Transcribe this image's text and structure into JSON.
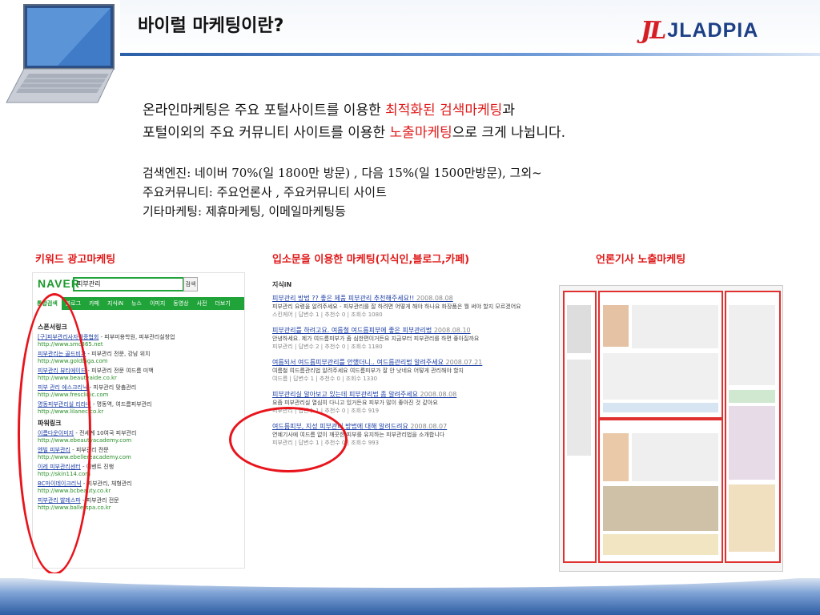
{
  "header": {
    "title": "바이럴 마케팅이란?",
    "logo_mark": "JL",
    "logo_text": "JLADPIA"
  },
  "intro": {
    "line1_a": "온라인마케팅은 주요 포털사이트를 이용한 ",
    "line1_red": "최적화된 검색마케팅",
    "line1_b": "과",
    "line2_a": "포털이외의 주요 커뮤니티 사이트를 이용한  ",
    "line2_red": "노출마케팅",
    "line2_b": "으로 크게 나뉩니다."
  },
  "details": [
    "검색엔진: 네이버 70%(일 1800만 방문) , 다음 15%(일 1500만방문), 그외~",
    "주요커뮤니티: 주요언론사 , 주요커뮤니티 사이트",
    "기타마케팅: 제휴마케팅, 이메일마케팅등"
  ],
  "captions": {
    "left": "키워드 광고마케팅",
    "middle": "입소문을 이용한 마케팅(지식인,블로그,카페)",
    "right": "언론기사 노출마케팅"
  },
  "naver": {
    "logo": "NAVER",
    "query": "피부관리",
    "search_btn": "검색",
    "tabs": [
      "통합검색",
      "블로그",
      "카페",
      "지식iN",
      "뉴스",
      "이미지",
      "동영상",
      "사전",
      "더보기"
    ],
    "sections": [
      {
        "title": "스폰서링크",
        "items": [
          {
            "link": "[구]피부관리사자격증협회",
            "desc": "- 피부미용학원, 피부관리실창업",
            "url": "http://www.smc365.net"
          },
          {
            "link": "피부관리는 골드비가",
            "desc": "- 피부관리 전문, 강남 위치",
            "url": "http://www.goldbiga.com"
          },
          {
            "link": "피부관리 뷰티에이드",
            "desc": "- 피부관리 전문 여드름 미백",
            "url": "http://www.beautyaide.co.kr"
          },
          {
            "link": "피부 관리 에스크리닉",
            "desc": "- 피부관리 맞춤관리",
            "url": "http://www.fresclinic.com"
          },
          {
            "link": "명동피부관리실 리라네",
            "desc": "- 명동역, 여드름피부관리",
            "url": "http://www.lilanec.co.kr"
          }
        ]
      },
      {
        "title": "파워링크",
        "items": [
          {
            "link": "이름다운이미지",
            "desc": "- 전세계 10여국 피부관리",
            "url": "http://www.ebeautyacademy.com"
          },
          {
            "link": "엔빌 피부관리",
            "desc": "- 피부관리 전문",
            "url": "http://www.ebellereacademy.com"
          },
          {
            "link": "이레 피부관리센터",
            "desc": "- 이벤트 진행",
            "url": "http://skin114.com"
          },
          {
            "link": "BC마이데이크리닉",
            "desc": "- 피부관리, 체형관리",
            "url": "http://www.bcbeauty.co.kr"
          },
          {
            "link": "피부관리 발레스파",
            "desc": "- 피부관리 전문",
            "url": "http://www.balletspa.co.kr"
          }
        ]
      }
    ]
  },
  "kin": {
    "header": "지식iN",
    "items": [
      {
        "title": "피부관리 방법 ?? 좋은 제품 피부관리 추천해주세요!!",
        "date": "2008.08.08",
        "desc": "피부관리 요령을 알려주세요 - 피부관리를 잘 하려면 어떻게 해야 하나요 화장품은 뭘 써야 할지 모르겠어요",
        "meta": "스킨케어 | 답변수 1 | 추천수 0 | 조회수 1080"
      },
      {
        "title": "피부관리를 하려고요. 여름철 여드름피부에 좋은 피부관리법",
        "date": "2008.08.10",
        "desc": "안녕하세요. 제가 여드름피부가 좀 심한편이거든요 지금부터 피부관리를 하면 좋아질까요",
        "meta": "피부관리 | 답변수 2 | 추천수 0 | 조회수 1180"
      },
      {
        "title": "여름되서 여드름피부관리를 안했더니.. 여드름관리법 알려주세요",
        "date": "2008.07.21",
        "desc": "여름철 여드름관리법 알려주세요 여드름피부가 잘 안 낫네요 어떻게 관리해야 할지",
        "meta": "여드름 | 답변수 1 | 추천수 0 | 조회수 1330"
      },
      {
        "title": "피부관리실 알아보고 있는데 피부관리법 좀 알려주세요",
        "date": "2008.08.08",
        "desc": "요즘 피부관리실 열심히 다니고 있거든요 피부가 많이 좋아진 것 같아요",
        "meta": "피부관리 | 답변수 1 | 추천수 0 | 조회수 919"
      },
      {
        "title": "여드름피부, 지성 피부관리 방법에 대해 알려드려요",
        "date": "2008.08.07",
        "desc": "연예기사에 여드름 없이 깨끗한 피부를 유지하는 피부관리법을 소개합니다",
        "meta": "피부관리 | 답변수 1 | 추천수 0 | 조회수 993"
      }
    ]
  },
  "colors": {
    "accent_red": "#e01a1a",
    "naver_green": "#20a339",
    "logo_blue": "#1d3f86",
    "footer_blue": "#2d5da3"
  }
}
